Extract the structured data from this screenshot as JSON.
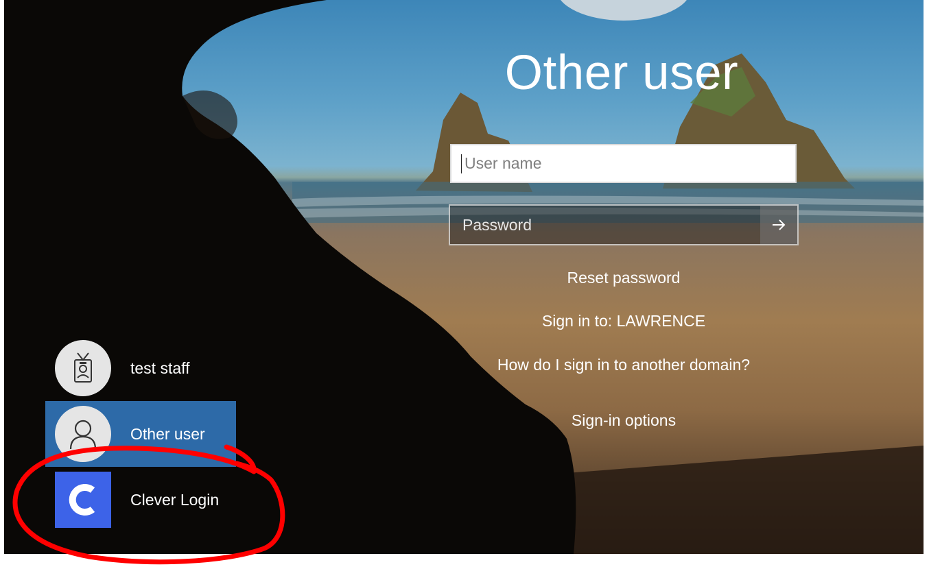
{
  "login": {
    "title": "Other user",
    "username_placeholder": "User name",
    "password_placeholder": "Password",
    "reset_password": "Reset password",
    "sign_in_to": "Sign in to: LAWRENCE",
    "other_domain_help": "How do I sign in to another domain?",
    "sign_in_options": "Sign-in options"
  },
  "users": [
    {
      "name": "test staff",
      "icon": "id-badge-icon"
    },
    {
      "name": "Other user",
      "icon": "user-icon",
      "selected": true
    },
    {
      "name": "Clever Login",
      "icon": "clever-logo-icon"
    }
  ],
  "annotation": {
    "color": "#ff0000",
    "shape": "hand-drawn-circle"
  }
}
